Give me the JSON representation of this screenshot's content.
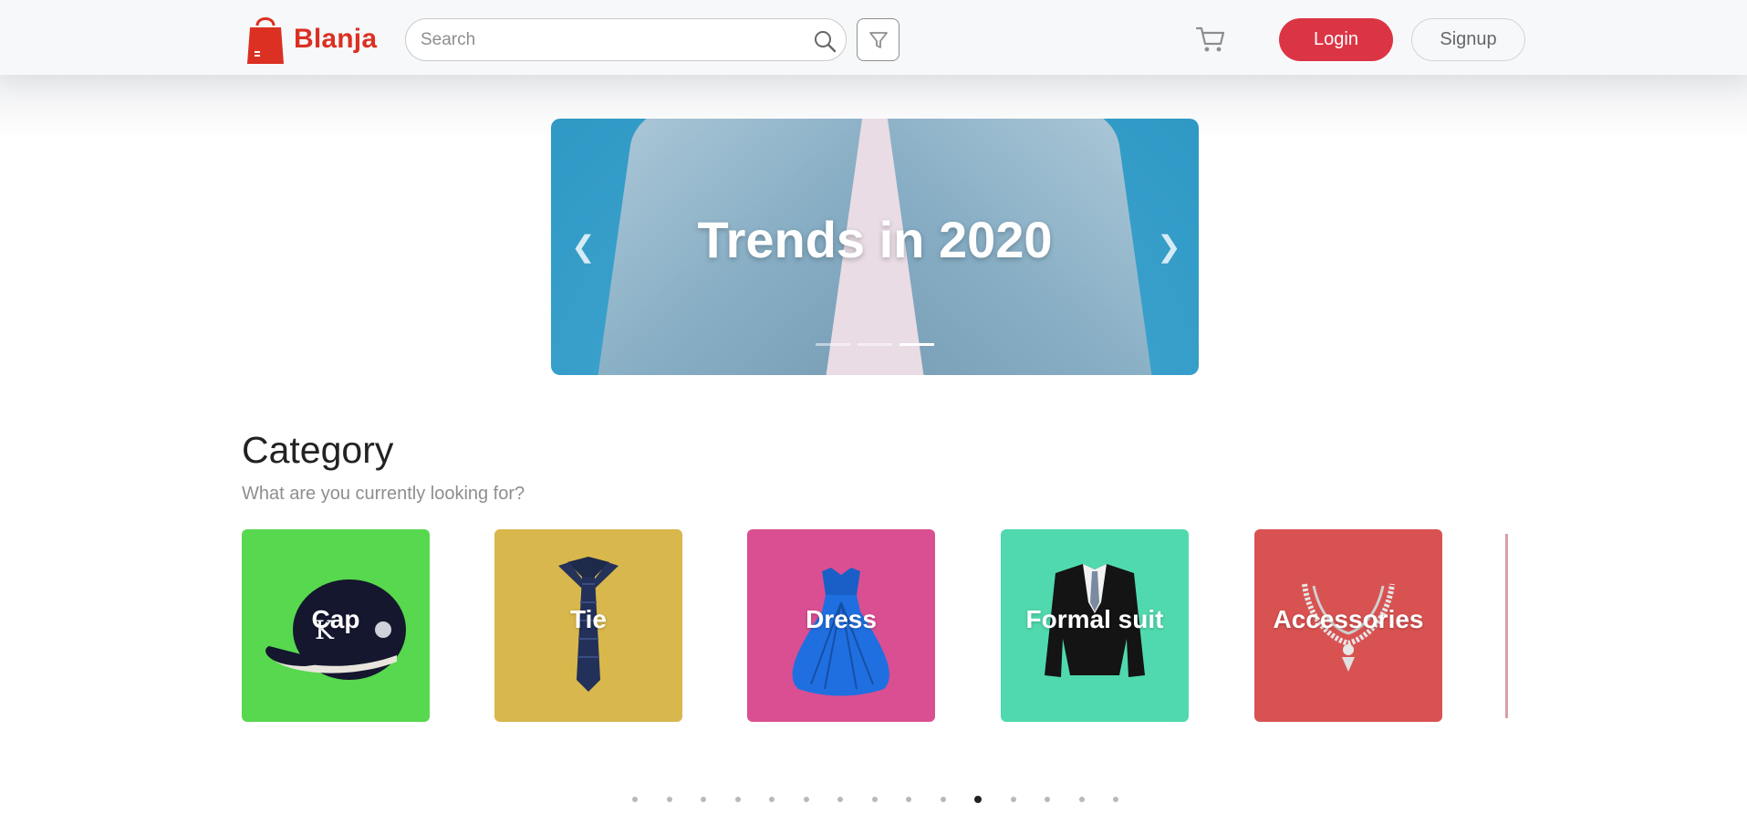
{
  "brand": {
    "name": "Blanja",
    "color": "#db3022"
  },
  "header": {
    "search_placeholder": "Search",
    "login_label": "Login",
    "signup_label": "Signup",
    "login_color": "#db3545"
  },
  "hero": {
    "title": "Trends in 2020",
    "slide_count": 3,
    "active_slide": 3
  },
  "category": {
    "title": "Category",
    "subtitle": "What are you currently looking for?",
    "items": [
      {
        "label": "Cap",
        "color": "#57d84e",
        "icon": "cap-icon"
      },
      {
        "label": "Tie",
        "color": "#d8b74c",
        "icon": "tie-icon"
      },
      {
        "label": "Dress",
        "color": "#da4f92",
        "icon": "dress-icon"
      },
      {
        "label": "Formal suit",
        "color": "#50d9ae",
        "icon": "suit-icon"
      },
      {
        "label": "Accessories",
        "color": "#d95252",
        "icon": "necklace-icon"
      }
    ]
  },
  "pagination": {
    "total": 15,
    "active": 11
  }
}
